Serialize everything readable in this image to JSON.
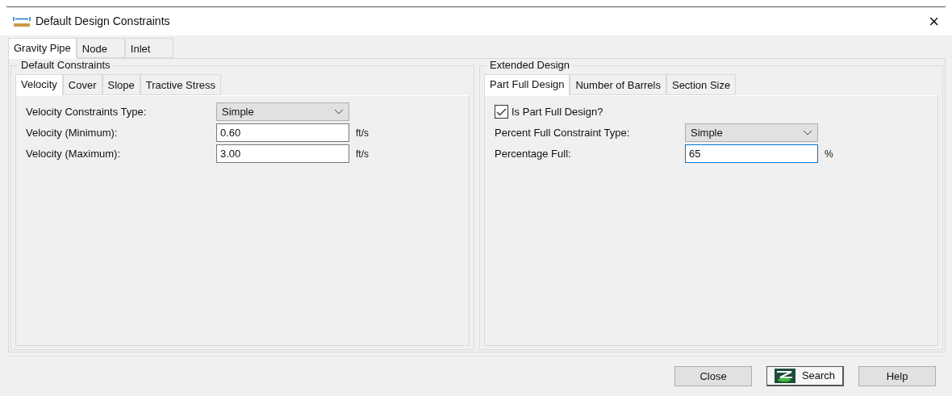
{
  "window": {
    "title": "Default Design Constraints",
    "close": "×"
  },
  "tabs": [
    {
      "label": "Gravity Pipe",
      "selected": true
    },
    {
      "label": "Node",
      "selected": false
    },
    {
      "label": "Inlet",
      "selected": false
    }
  ],
  "groups": [
    {
      "title": "Default Constraints",
      "tabs": [
        {
          "label": "Velocity",
          "selected": true
        },
        {
          "label": "Cover",
          "selected": false
        },
        {
          "label": "Slope",
          "selected": false
        },
        {
          "label": "Tractive Stress",
          "selected": false
        }
      ],
      "rows": [
        {
          "kind": "dropdown",
          "label": "Velocity Constraints Type:",
          "value": "Simple"
        },
        {
          "kind": "text",
          "label": "Velocity (Minimum):",
          "value": "0.60",
          "unit": "ft/s",
          "focused": false
        },
        {
          "kind": "text",
          "label": "Velocity (Maximum):",
          "value": "3.00",
          "unit": "ft/s",
          "focused": false
        }
      ]
    },
    {
      "title": "Extended Design",
      "tabs": [
        {
          "label": "Part Full Design",
          "selected": true
        },
        {
          "label": "Number of Barrels",
          "selected": false
        },
        {
          "label": "Section Size",
          "selected": false
        }
      ],
      "rows": [
        {
          "kind": "checkbox",
          "label": "Is Part Full Design?",
          "checked": true
        },
        {
          "kind": "dropdown",
          "label": "Percent Full Constraint Type:",
          "value": "Simple"
        },
        {
          "kind": "text",
          "label": "Percentage Full:",
          "value": "65",
          "unit": "%",
          "focused": true
        }
      ]
    }
  ],
  "buttons": [
    {
      "label": "Close",
      "kind": "plain"
    },
    {
      "label": "Search",
      "kind": "icon"
    },
    {
      "label": "Help",
      "kind": "plain"
    }
  ]
}
